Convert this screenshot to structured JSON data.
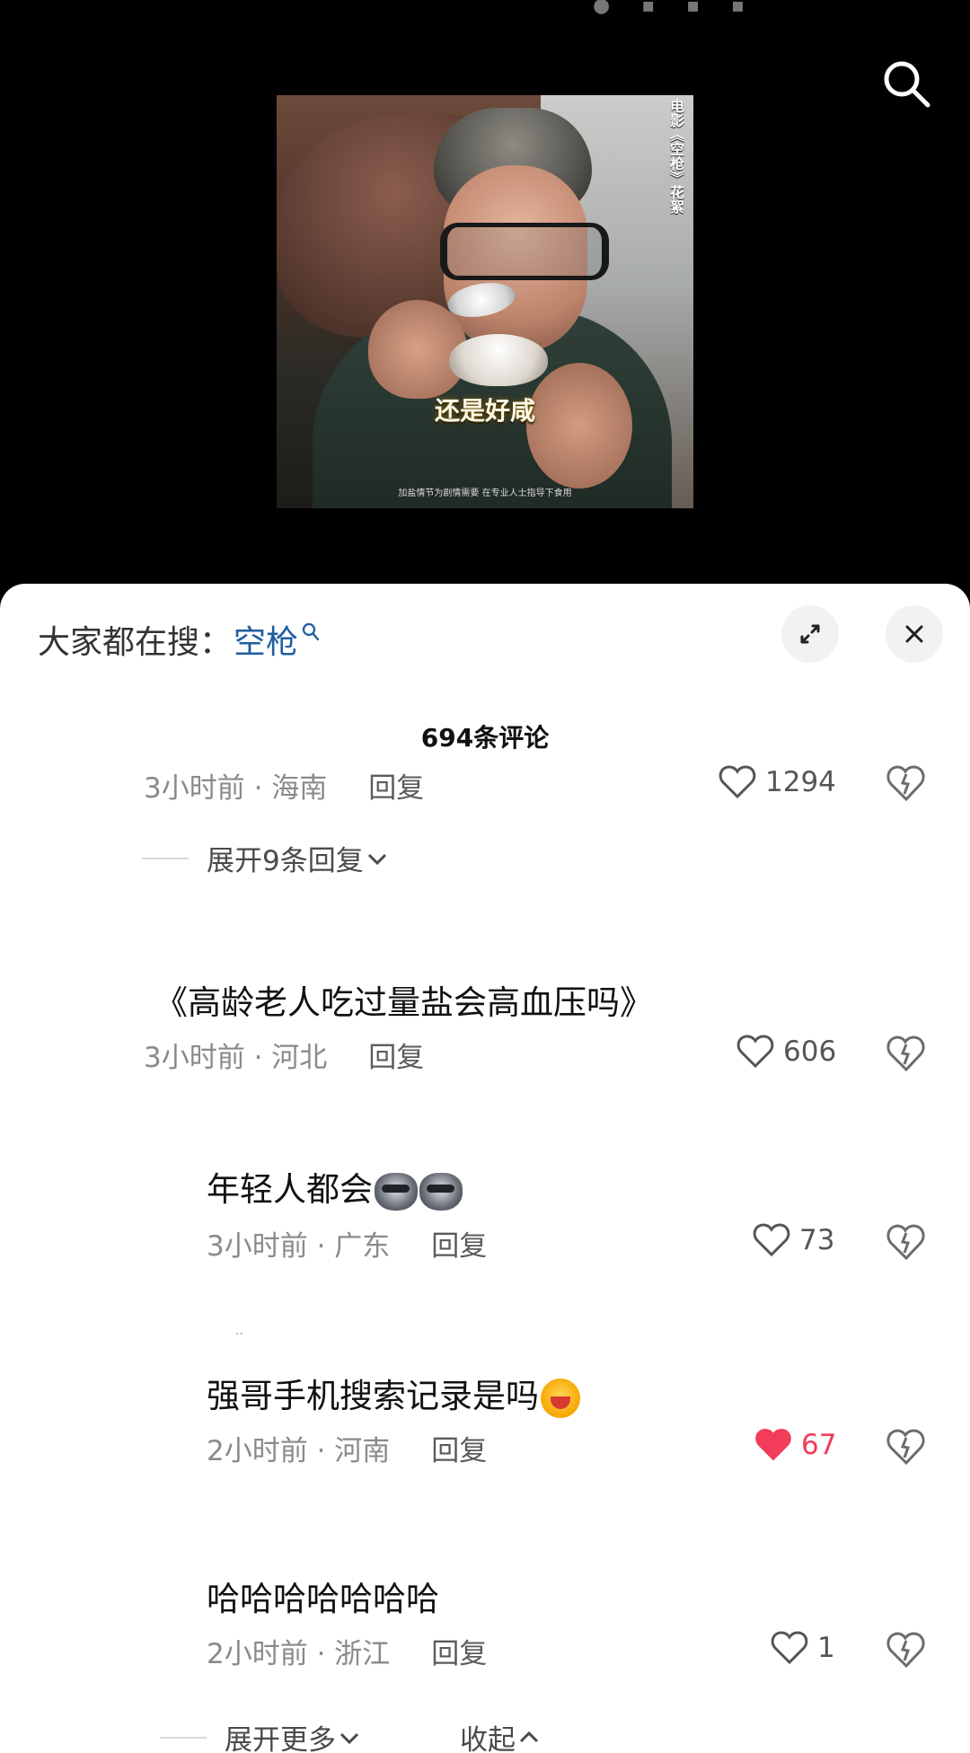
{
  "video": {
    "side_caption": "电影《空枪》花絮",
    "subtitle": "还是好咸",
    "notice": "加盐情节为剧情需要 在专业人士指导下食用"
  },
  "sheet": {
    "trending_label": "大家都在搜：",
    "trending_keyword": "空枪",
    "comment_count": "694条评论"
  },
  "comments": [
    {
      "text": "",
      "time_location": "3小时前 · 海南",
      "reply": "回复",
      "likes": "1294",
      "liked": false,
      "expand": "展开9条回复"
    },
    {
      "text": "《高龄老人吃过量盐会高血压吗》",
      "time_location": "3小时前 · 河北",
      "reply": "回复",
      "likes": "606",
      "liked": false
    },
    {
      "text": "年轻人都会",
      "time_location": "3小时前 · 广东",
      "reply": "回复",
      "likes": "73",
      "liked": false,
      "emoji": [
        "dog",
        "dog"
      ]
    },
    {
      "text": "强哥手机搜索记录是吗",
      "time_location": "2小时前 · 河南",
      "reply": "回复",
      "likes": "67",
      "liked": true,
      "emoji": [
        "laugh"
      ]
    },
    {
      "text": "哈哈哈哈哈哈哈",
      "time_location": "2小时前 · 浙江",
      "reply": "回复",
      "likes": "1",
      "liked": false
    }
  ],
  "footer": {
    "expand_more": "展开更多",
    "collapse": "收起"
  },
  "decorations": {
    "dots": ".."
  },
  "colors": {
    "link": "#1f5e9f",
    "like_red": "#f23c5a"
  }
}
